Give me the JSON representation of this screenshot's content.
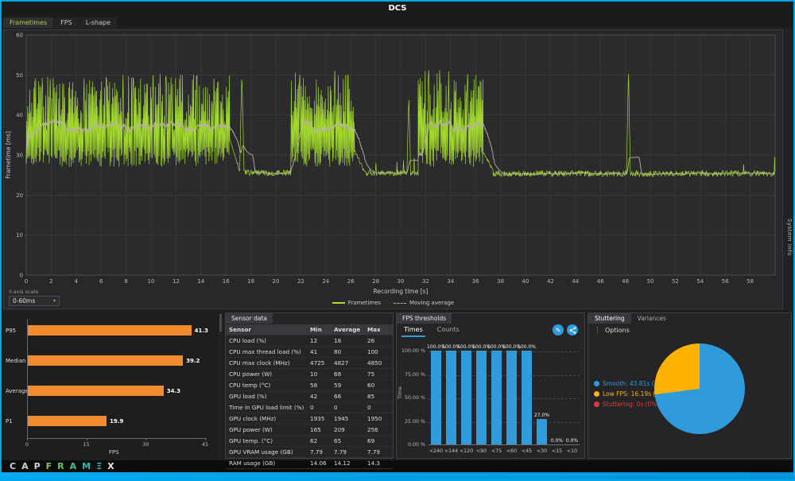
{
  "window": {
    "title": "DCS"
  },
  "accent": "#00a7e8",
  "main_tabs": [
    {
      "label": "Frametimes",
      "selected": true
    },
    {
      "label": "FPS",
      "selected": false
    },
    {
      "label": "L-shape",
      "selected": false
    }
  ],
  "system_info_label": "System Info",
  "yaxis_scale": {
    "label": "Y-axis scale",
    "value": "0-60ms"
  },
  "sensor_panel": {
    "tab_label": "Sensor data",
    "headers": [
      "Sensor",
      "Min",
      "Average",
      "Max"
    ],
    "rows": [
      [
        "CPU load (%)",
        "12",
        "18",
        "26"
      ],
      [
        "CPU max thread load (%)",
        "41",
        "80",
        "100"
      ],
      [
        "CPU max clock (MHz)",
        "4725",
        "4827",
        "4850"
      ],
      [
        "CPU power (W)",
        "10",
        "68",
        "75"
      ],
      [
        "CPU temp (°C)",
        "58",
        "59",
        "60"
      ],
      [
        "GPU load (%)",
        "42",
        "66",
        "85"
      ],
      [
        "Time in GPU load limit (%)",
        "0",
        "0",
        "0"
      ],
      [
        "GPU clock (MHz)",
        "1935",
        "1945",
        "1950"
      ],
      [
        "GPU power (W)",
        "165",
        "209",
        "256"
      ],
      [
        "GPU temp. (°C)",
        "62",
        "65",
        "69"
      ],
      [
        "GPU VRAM usage (GB)",
        "7.79",
        "7.79",
        "7.79"
      ],
      [
        "RAM usage (GB)",
        "14.06",
        "14.12",
        "14.3"
      ]
    ]
  },
  "thresholds_panel": {
    "tab_label": "FPS thresholds",
    "tabs": [
      {
        "label": "Times",
        "selected": true
      },
      {
        "label": "Counts",
        "selected": false
      }
    ]
  },
  "stuttering_panel": {
    "tabs": [
      {
        "label": "Stuttering",
        "selected": true
      },
      {
        "label": "Variances",
        "selected": false
      }
    ],
    "options_label": "Options"
  },
  "logo": {
    "letters": [
      {
        "ch": "C",
        "color": "#cfd2d4"
      },
      {
        "ch": "A",
        "color": "#cfd2d4"
      },
      {
        "ch": "P",
        "color": "#cfd2d4"
      },
      {
        "ch": "F",
        "color": "#86c540"
      },
      {
        "ch": "R",
        "color": "#63c56b"
      },
      {
        "ch": "A",
        "color": "#45c393"
      },
      {
        "ch": "M",
        "color": "#2bbfb0"
      },
      {
        "ch": "Ξ",
        "color": "#17bcc6"
      },
      {
        "ch": "X",
        "color": "#e6e8ea"
      }
    ]
  },
  "chart_data": [
    {
      "id": "frametimes",
      "type": "line",
      "xlabel": "Recording time [s]",
      "ylabel": "Frametime [ms]",
      "xlim": [
        0,
        60
      ],
      "ylim": [
        0,
        60
      ],
      "x_tick_step": 2,
      "x_tick_label_max": 58,
      "y_tick_step": 10,
      "series": [
        {
          "name": "Frametimes",
          "color": "#a9e22e",
          "dash": false
        },
        {
          "name": "Moving average",
          "color": "#b9b3a3",
          "dash": true
        }
      ],
      "segments": [
        {
          "t0": 0,
          "t1": 16.3,
          "mode": "busy",
          "lo": 27,
          "hi": 49
        },
        {
          "t0": 16.3,
          "t1": 17.1,
          "mode": "ramp",
          "from": 34,
          "to": 26
        },
        {
          "t0": 17.1,
          "t1": 17.45,
          "mode": "spike",
          "base": 26,
          "peak": 51
        },
        {
          "t0": 17.45,
          "t1": 21.2,
          "mode": "flat",
          "base": 25.6
        },
        {
          "t0": 21.2,
          "t1": 26.3,
          "mode": "busy",
          "lo": 27,
          "hi": 50
        },
        {
          "t0": 26.3,
          "t1": 27.1,
          "mode": "ramp",
          "from": 31,
          "to": 26
        },
        {
          "t0": 27.1,
          "t1": 30.5,
          "mode": "flat",
          "base": 25.6
        },
        {
          "t0": 30.5,
          "t1": 30.8,
          "mode": "spike",
          "base": 26,
          "peak": 45
        },
        {
          "t0": 30.8,
          "t1": 31.4,
          "mode": "flat",
          "base": 25.6
        },
        {
          "t0": 31.4,
          "t1": 36.6,
          "mode": "busy",
          "lo": 27,
          "hi": 50
        },
        {
          "t0": 36.6,
          "t1": 37.4,
          "mode": "ramp",
          "from": 31,
          "to": 26
        },
        {
          "t0": 37.4,
          "t1": 48.1,
          "mode": "flat",
          "base": 25.4
        },
        {
          "t0": 48.1,
          "t1": 48.4,
          "mode": "spike",
          "base": 26,
          "peak": 52
        },
        {
          "t0": 48.4,
          "t1": 60.0,
          "mode": "flat",
          "base": 25.4
        }
      ]
    },
    {
      "id": "fps_percentiles",
      "type": "bar",
      "orientation": "horizontal",
      "categories": [
        "P95",
        "Median",
        "Average",
        "P1"
      ],
      "values": [
        41.3,
        39.2,
        34.3,
        19.9
      ],
      "xlabel": "FPS",
      "xlim": [
        0,
        45
      ],
      "x_ticks": [
        0,
        15,
        30,
        45
      ],
      "bar_color": "#f28b30"
    },
    {
      "id": "fps_thresholds",
      "type": "bar",
      "categories": [
        "<240",
        "<144",
        "<120",
        "<90",
        "<75",
        "<60",
        "<45",
        "<30",
        "<15",
        "<10"
      ],
      "values": [
        100,
        100,
        100,
        100,
        100,
        100,
        100,
        27,
        0,
        0
      ],
      "labels": [
        "100.0%",
        "100.0%",
        "100.0%",
        "100.0%",
        "100.0%",
        "100.0%",
        "100.0%",
        "27.0%",
        "0.0%",
        "0.0%"
      ],
      "ylabel": "Time",
      "y_ticks": [
        "100.00 %",
        "75.00 %",
        "50.00 %",
        "25.00 %",
        "0.00 %"
      ],
      "bar_color": "#2f9bdb"
    },
    {
      "id": "stuttering_pie",
      "type": "pie",
      "slices": [
        {
          "label": "Smooth",
          "value_text": "43.81s",
          "percent": 73,
          "color": "#2f9bdb"
        },
        {
          "label": "Low FPS",
          "value_text": "16.19s",
          "percent": 27,
          "color": "#ffb300"
        },
        {
          "label": "Stuttering",
          "value_text": "0s",
          "percent": 0,
          "color": "#e53935"
        }
      ]
    }
  ]
}
